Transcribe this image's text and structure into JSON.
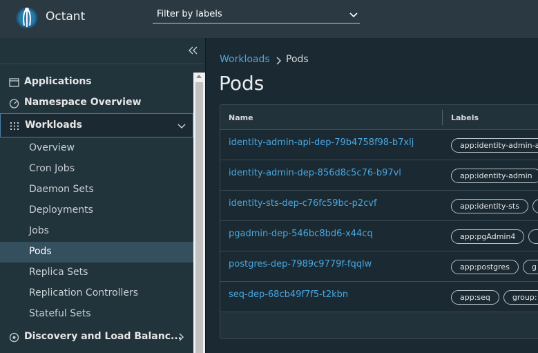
{
  "app": {
    "title": "Octant"
  },
  "filter": {
    "label": "Filter by labels"
  },
  "sidebar": {
    "items": [
      {
        "label": "Applications",
        "icon": "window-icon"
      },
      {
        "label": "Namespace Overview",
        "icon": "dashboard-icon"
      },
      {
        "label": "Workloads",
        "icon": "grid-icon",
        "expanded": true
      },
      {
        "label": "Discovery and Load Balanc...",
        "icon": "network-icon",
        "expanded": false
      }
    ],
    "workloads_sub": [
      "Overview",
      "Cron Jobs",
      "Daemon Sets",
      "Deployments",
      "Jobs",
      "Pods",
      "Replica Sets",
      "Replication Controllers",
      "Stateful Sets"
    ],
    "active": "Pods"
  },
  "breadcrumb": {
    "parent": "Workloads",
    "current": "Pods"
  },
  "page": {
    "title": "Pods"
  },
  "table": {
    "columns": [
      "Name",
      "Labels"
    ],
    "rows": [
      {
        "name": "identity-admin-api-dep-79b4758f98-b7xlj",
        "labels": [
          "app:identity-admin-a"
        ]
      },
      {
        "name": "identity-admin-dep-856d8c5c76-b97vl",
        "labels": [
          "app:identity-admin",
          ""
        ]
      },
      {
        "name": "identity-sts-dep-c76fc59bc-p2cvf",
        "labels": [
          "app:identity-sts",
          ""
        ]
      },
      {
        "name": "pgadmin-dep-546bc8bd6-x44cq",
        "labels": [
          "app:pgAdmin4",
          ""
        ]
      },
      {
        "name": "postgres-dep-7989c9779f-fqqlw",
        "labels": [
          "app:postgres",
          "g"
        ]
      },
      {
        "name": "seq-dep-68cb49f7f5-t2kbn",
        "labels": [
          "app:seq",
          "group:"
        ]
      }
    ]
  },
  "colors": {
    "accent": "#49a6e0",
    "header": "#2b3a42",
    "sidebar": "#21333b",
    "background": "#1b2a32"
  }
}
